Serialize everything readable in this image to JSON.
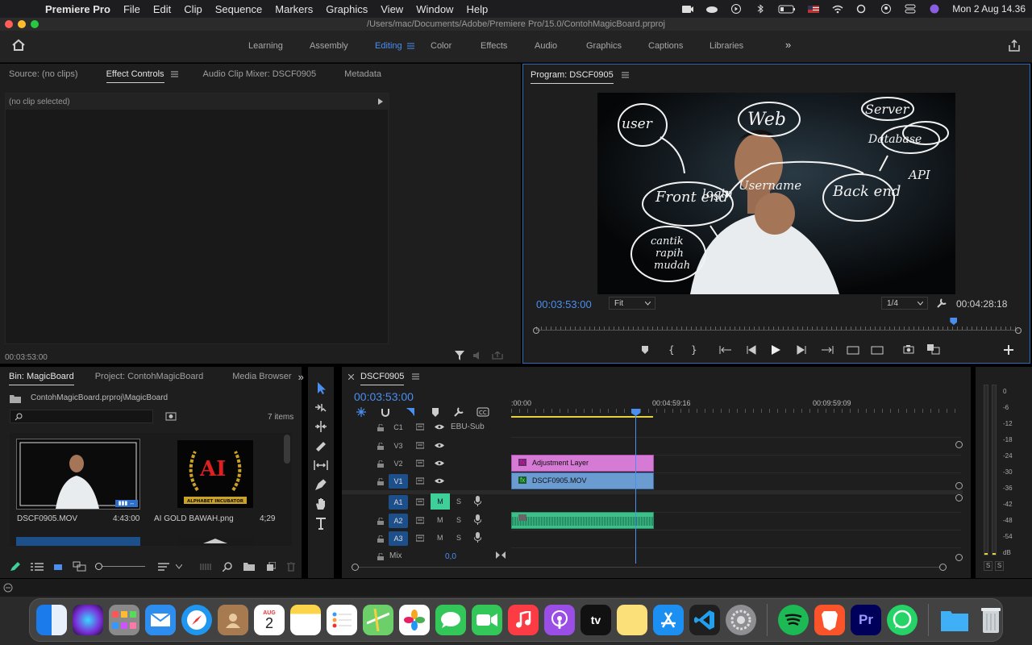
{
  "menubar": {
    "app_name": "Premiere Pro",
    "menus": [
      "File",
      "Edit",
      "Clip",
      "Sequence",
      "Markers",
      "Graphics",
      "View",
      "Window",
      "Help"
    ],
    "clock": "Mon 2 Aug  14.36"
  },
  "window": {
    "title": "/Users/mac/Documents/Adobe/Premiere Pro/15.0/ContohMagicBoard.prproj"
  },
  "workspaces": {
    "tabs": [
      "Learning",
      "Assembly",
      "Editing",
      "Color",
      "Effects",
      "Audio",
      "Graphics",
      "Captions",
      "Libraries"
    ],
    "active": "Editing",
    "more": "»"
  },
  "effect_panel": {
    "tabs": [
      "Source: (no clips)",
      "Effect Controls",
      "Audio Clip Mixer: DSCF0905",
      "Metadata"
    ],
    "active_tab": "Effect Controls",
    "empty_text": "(no clip selected)",
    "timecode": "00:03:53:00"
  },
  "program_monitor": {
    "title": "Program: DSCF0905",
    "current_tc": "00:03:53:00",
    "fit_label": "Fit",
    "resolution": "1/4",
    "duration_tc": "00:04:28:18",
    "playhead_fraction": 0.866,
    "whiteboard_words": [
      "user",
      "Web",
      "Server",
      "Database",
      "API",
      "Front end",
      "login",
      "Username",
      "Back end",
      "cantik",
      "rapih",
      "mudah"
    ]
  },
  "bin_panel": {
    "tabs": [
      "Bin: MagicBoard",
      "Project: ContohMagicBoard",
      "Media Browser"
    ],
    "active_tab": "Bin: MagicBoard",
    "path": "ContohMagicBoard.prproj\\MagicBoard",
    "search_placeholder": "",
    "item_count": "7 items",
    "items": [
      {
        "name": "DSCF0905.MOV",
        "duration": "4:43:00"
      },
      {
        "name": "AI GOLD BAWAH.png",
        "duration": "4;29"
      }
    ],
    "logo_letters": "AI",
    "logo_caption": "ALPHABET INCUBATOR"
  },
  "timeline": {
    "sequence_name": "DSCF0905",
    "current_tc": "00:03:53:00",
    "ruler_labels": [
      ":00:00",
      "00:04:59:16",
      "00:09:59:09"
    ],
    "tracks": [
      {
        "name": "C1",
        "label": "EBU-Sub",
        "type": "caption"
      },
      {
        "name": "V3",
        "type": "video"
      },
      {
        "name": "V2",
        "type": "video"
      },
      {
        "name": "V1",
        "type": "video",
        "targeted": true
      },
      {
        "name": "A1",
        "type": "audio",
        "targeted": true,
        "mute_on": true
      },
      {
        "name": "A2",
        "type": "audio"
      },
      {
        "name": "A3",
        "type": "audio"
      }
    ],
    "mix_label": "Mix",
    "mix_value": "0,0",
    "mute_letter": "M",
    "solo_letter": "S",
    "clips": {
      "adjustment": "Adjustment Layer",
      "video": "DSCF0905.MOV",
      "fx": "fx"
    }
  },
  "meters": {
    "scale": [
      "0",
      "-6",
      "-12",
      "-18",
      "-24",
      "-30",
      "-36",
      "-42",
      "-48",
      "-54",
      "dB"
    ],
    "solo_buttons": [
      "S",
      "S"
    ]
  },
  "dock": {
    "calendar_month": "AUG",
    "calendar_day": "2",
    "tv_label": "tv",
    "premiere_label": "Pr"
  },
  "colors": {
    "accent_blue": "#4a8ef0",
    "adjustment_clip": "#d57ad5",
    "video_clip": "#6a9bd1",
    "audio_clip": "#3dbf8a",
    "mute_active": "#3fd09a"
  }
}
